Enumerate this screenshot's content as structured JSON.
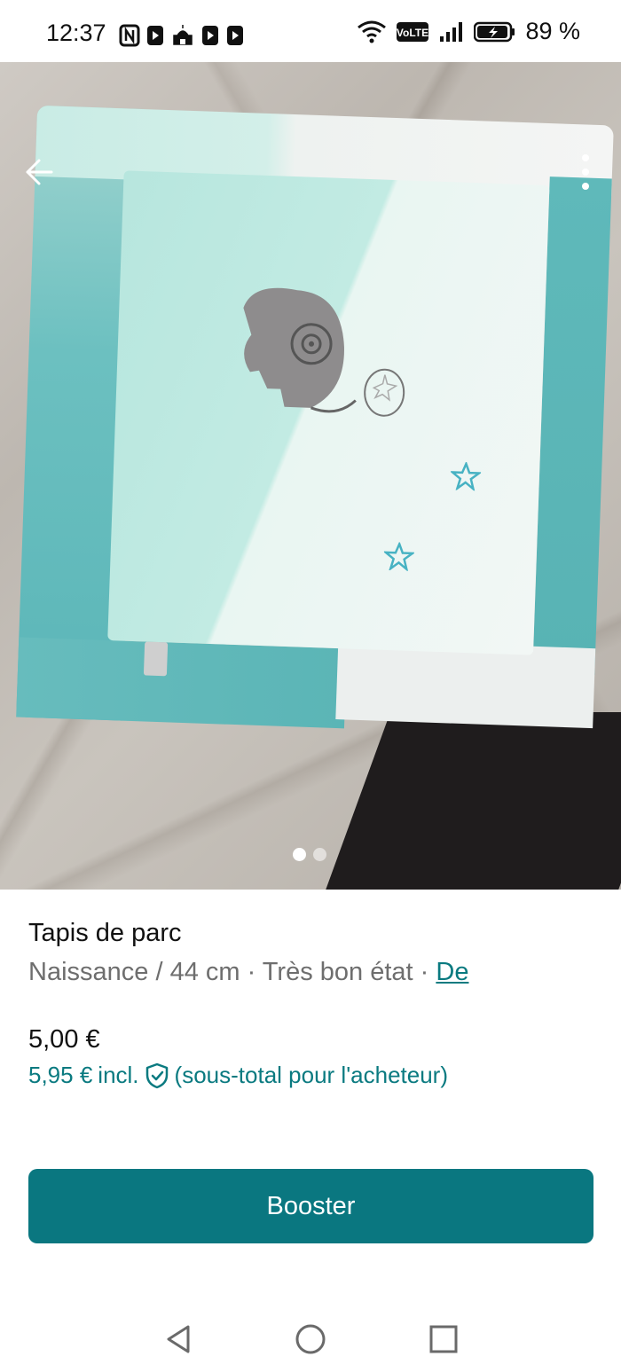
{
  "status_bar": {
    "time": "12:37",
    "battery_percent": "89 %",
    "network_label": "VoLTE",
    "icons": [
      "nfc-icon",
      "app-notification-icon",
      "mosque-icon",
      "app-notification-icon",
      "app-notification-icon",
      "wifi-icon",
      "volte-icon",
      "signal-icon",
      "battery-charging-icon"
    ]
  },
  "top_controls": {
    "back_icon": "arrow-left-icon",
    "more_icon": "more-vertical-icon"
  },
  "carousel": {
    "total_photos": 2,
    "active_index": 0
  },
  "item": {
    "title": "Tapis de parc",
    "size": "Naissance / 44 cm",
    "separator": " · ",
    "condition": "Très bon état",
    "brand_link": "De",
    "price": "5,00 €",
    "buyer_price": "5,95 €",
    "buyer_incl": "incl.",
    "buyer_note": "(sous-total pour l'acheteur)"
  },
  "actions": {
    "booster_label": "Booster"
  },
  "colors": {
    "accent": "#0a7780",
    "link": "#0a7a80",
    "muted_text": "#6e6e6e"
  },
  "nav_bar": {
    "icons": [
      "back-triangle-icon",
      "home-circle-icon",
      "recents-square-icon"
    ]
  }
}
